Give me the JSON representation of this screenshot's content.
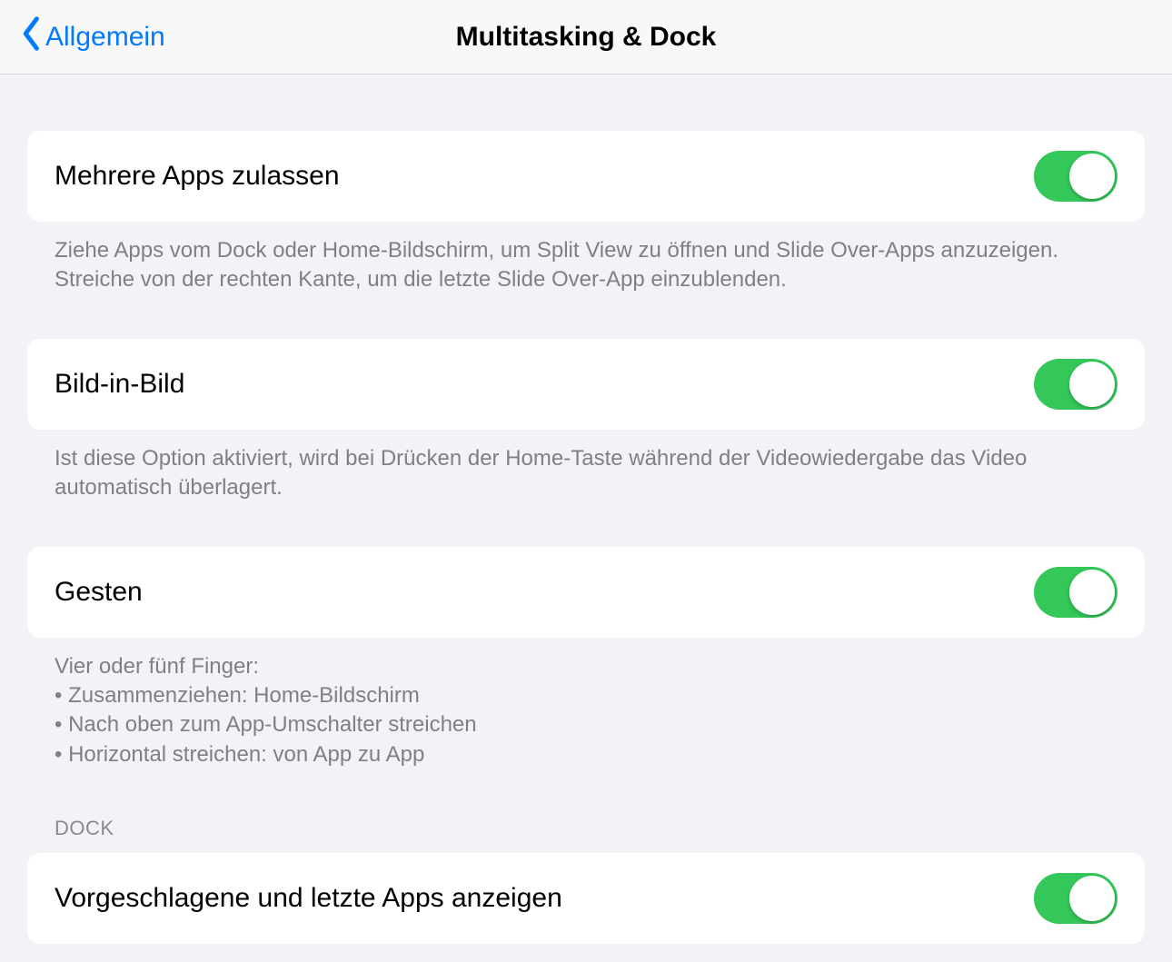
{
  "header": {
    "back_label": "Allgemein",
    "title": "Multitasking & Dock"
  },
  "groups": {
    "multiple_apps": {
      "label": "Mehrere Apps zulassen",
      "footer": "Ziehe Apps vom Dock oder Home-Bildschirm, um Split View zu öffnen und Slide Over-Apps anzuzeigen. Streiche von der rechten Kante, um die letzte Slide Over-App einzublenden.",
      "on": true
    },
    "pip": {
      "label": "Bild-in-Bild",
      "footer": "Ist diese Option aktiviert, wird bei Drücken der Home-Taste während der Videowiedergabe das Video automatisch überlagert.",
      "on": true
    },
    "gestures": {
      "label": "Gesten",
      "footer_intro": "Vier oder fünf Finger:",
      "footer_bullet1": "• Zusammenziehen: Home-Bildschirm",
      "footer_bullet2": "• Nach oben zum App-Umschalter streichen",
      "footer_bullet3": "• Horizontal streichen: von App zu App",
      "on": true
    },
    "dock": {
      "header": "DOCK",
      "label": "Vorgeschlagene und letzte Apps anzeigen",
      "on": true
    }
  }
}
